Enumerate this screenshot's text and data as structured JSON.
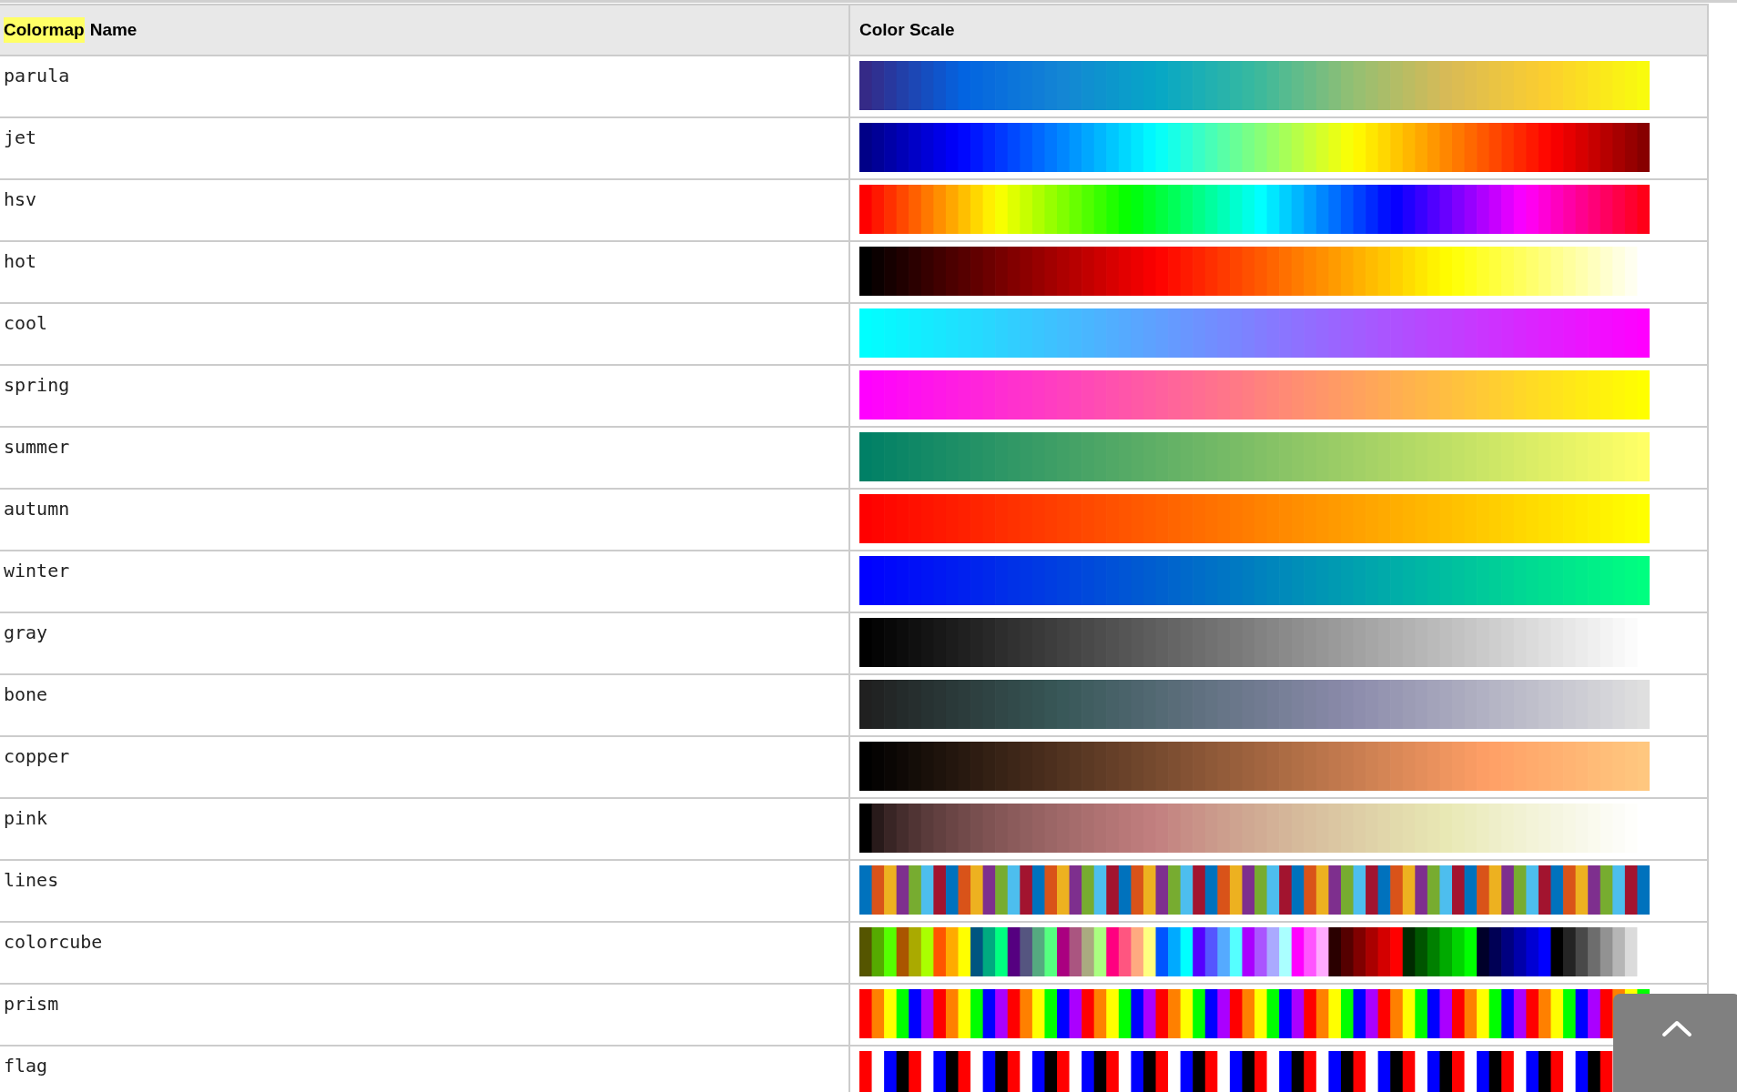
{
  "table": {
    "columns": [
      {
        "highlighted": "Colormap",
        "text": "Name"
      },
      {
        "text": "Color Scale"
      }
    ],
    "rows": [
      {
        "name": "parula"
      },
      {
        "name": "jet"
      },
      {
        "name": "hsv"
      },
      {
        "name": "hot"
      },
      {
        "name": "cool"
      },
      {
        "name": "spring"
      },
      {
        "name": "summer"
      },
      {
        "name": "autumn"
      },
      {
        "name": "winter"
      },
      {
        "name": "gray"
      },
      {
        "name": "bone"
      },
      {
        "name": "copper"
      },
      {
        "name": "pink"
      },
      {
        "name": "lines"
      },
      {
        "name": "colorcube"
      },
      {
        "name": "prism"
      },
      {
        "name": "flag"
      }
    ]
  }
}
